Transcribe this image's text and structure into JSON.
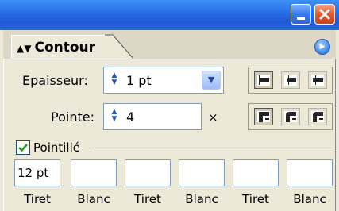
{
  "window": {
    "minimize_icon": "minimize-icon",
    "close_icon": "close-icon"
  },
  "panel": {
    "tab_label": "Contour",
    "tab_icon": "collapse-arrows-icon",
    "menu_icon": "panel-menu-arrow-icon"
  },
  "stroke": {
    "weight_label": "Epaisseur:",
    "weight_value": "1 pt",
    "miter_label": "Pointe:",
    "miter_value": "4",
    "miter_suffix": "×",
    "cap_buttons": [
      "butt-cap-icon",
      "round-cap-icon",
      "projecting-cap-icon"
    ],
    "join_buttons": [
      "miter-join-icon",
      "round-join-icon",
      "bevel-join-icon"
    ]
  },
  "dashed": {
    "label": "Pointillé",
    "checked": true,
    "boxes": [
      {
        "value": "12 pt",
        "label": "Tiret"
      },
      {
        "value": "",
        "label": "Blanc"
      },
      {
        "value": "",
        "label": "Tiret"
      },
      {
        "value": "",
        "label": "Blanc"
      },
      {
        "value": "",
        "label": "Tiret"
      },
      {
        "value": "",
        "label": "Blanc"
      }
    ]
  }
}
